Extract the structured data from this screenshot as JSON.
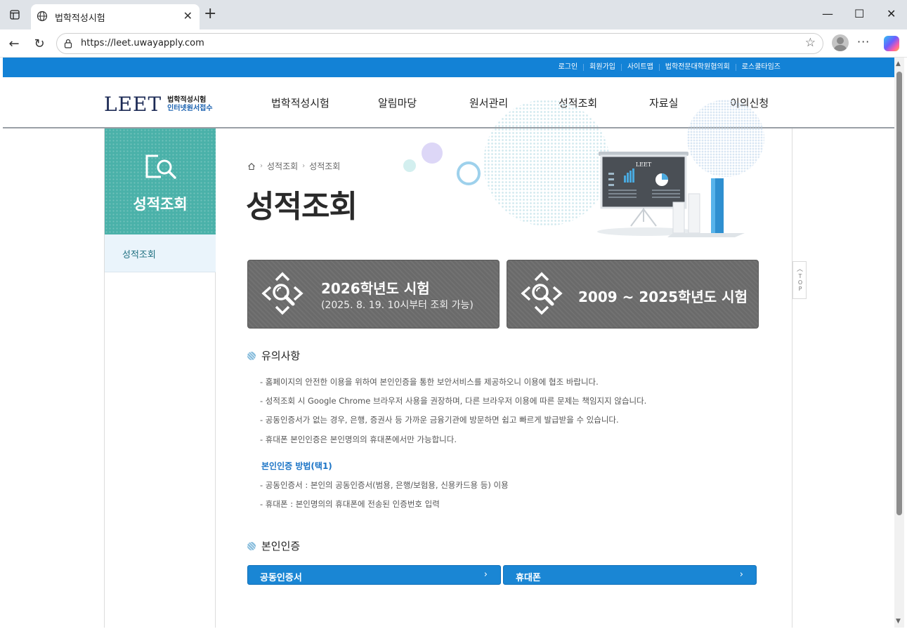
{
  "browser": {
    "tab_title": "법학적성시험",
    "url": "https://leet.uwayapply.com"
  },
  "utility_links": [
    "로그인",
    "회원가입",
    "사이트맵",
    "법학전문대학원협의회",
    "로스쿨타임즈"
  ],
  "logo": {
    "mark": "LEET",
    "sub_line1": "법학적성시험",
    "sub_line2": "인터넷원서접수"
  },
  "menu": [
    "법학적성시험",
    "알림마당",
    "원서관리",
    "성적조회",
    "자료실",
    "이의신청"
  ],
  "sidebar": {
    "title": "성적조회",
    "items": [
      "성적조회"
    ]
  },
  "breadcrumb": [
    "성적조회",
    "성적조회"
  ],
  "page_title": "성적조회",
  "hero_board_text": "LEET",
  "exam_buttons": [
    {
      "line1": "2026학년도 시험",
      "line2": "(2025. 8. 19. 10시부터 조회 가능)"
    },
    {
      "line1": "2009 ~ 2025학년도 시험",
      "line2": ""
    }
  ],
  "notice": {
    "title": "유의사항",
    "items": [
      "- 홈페이지의 안전한 이용을 위하여 본인인증을 통한 보안서비스를 제공하오니 이용에 협조 바랍니다.",
      "- 성적조회 시 Google Chrome 브라우저 사용을 권장하며, 다른 브라우저 이용에 따른 문제는 책임지지 않습니다.",
      "- 공동인증서가 없는 경우, 은행, 증권사 등 가까운 금융기관에 방문하면 쉽고 빠르게 발급받을 수 있습니다.",
      "- 휴대폰 본인인증은 본인명의의 휴대폰에서만 가능합니다."
    ],
    "method_title": "본인인증 방법(택1)",
    "method_items": [
      "- 공동인증서 : 본인의 공동인증서(범용, 은행/보험용, 신용카드용 등) 이용",
      "- 휴대폰 : 본인명의의 휴대폰에 전송된 인증번호 입력"
    ]
  },
  "auth": {
    "title": "본인인증",
    "buttons": [
      "공동인증서",
      "휴대폰"
    ]
  },
  "top_button": "TOP",
  "colors": {
    "brand_blue": "#1382d6",
    "sidebar_teal": "#4ab1a9",
    "button_gray": "#6a6a6a",
    "auth_button_blue": "#1a86d4"
  }
}
